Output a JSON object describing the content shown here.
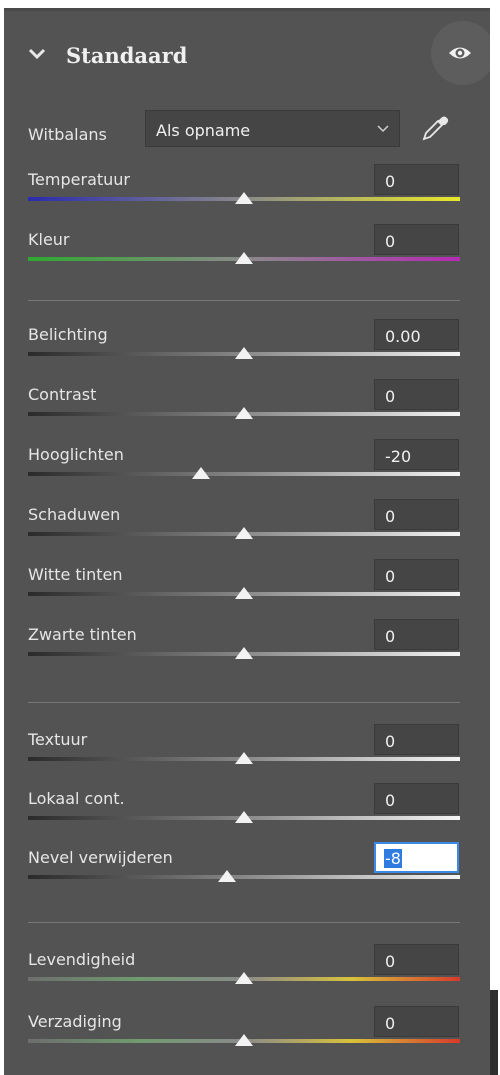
{
  "section": {
    "title": "Standaard"
  },
  "white_balance": {
    "label": "Witbalans",
    "value": "Als opname"
  },
  "groups": [
    [
      {
        "label": "Temperatuur",
        "value": "0",
        "position": 0.5,
        "gradient": "linear-gradient(to right,#2b2bb0,#8a8a8a 50%,#e8e82a)"
      },
      {
        "label": "Kleur",
        "value": "0",
        "position": 0.5,
        "gradient": "linear-gradient(to right,#2fa82f,#8a8a8a 50%,#b52ab5)"
      }
    ],
    [
      {
        "label": "Belichting",
        "value": "0.00",
        "position": 0.5,
        "gradient": "linear-gradient(to right,#2a2a2a,#888 50%,#f5f5f5)"
      },
      {
        "label": "Contrast",
        "value": "0",
        "position": 0.5,
        "gradient": "linear-gradient(to right,#2a2a2a,#888 50%,#f5f5f5)"
      },
      {
        "label": "Hooglichten",
        "value": "-20",
        "position": 0.4,
        "gradient": "linear-gradient(to right,#2a2a2a,#888 50%,#f5f5f5)"
      },
      {
        "label": "Schaduwen",
        "value": "0",
        "position": 0.5,
        "gradient": "linear-gradient(to right,#2a2a2a,#888 50%,#f5f5f5)"
      },
      {
        "label": "Witte tinten",
        "value": "0",
        "position": 0.5,
        "gradient": "linear-gradient(to right,#2a2a2a,#888 50%,#f5f5f5)"
      },
      {
        "label": "Zwarte tinten",
        "value": "0",
        "position": 0.5,
        "gradient": "linear-gradient(to right,#2a2a2a,#888 50%,#f5f5f5)"
      }
    ],
    [
      {
        "label": "Textuur",
        "value": "0",
        "position": 0.5,
        "gradient": "linear-gradient(to right,#2a2a2a,#888 50%,#f5f5f5)"
      },
      {
        "label": "Lokaal cont.",
        "value": "0",
        "position": 0.5,
        "gradient": "linear-gradient(to right,#2a2a2a,#888 50%,#f5f5f5)"
      },
      {
        "label": "Nevel verwijderen",
        "value": "-8",
        "position": 0.46,
        "active": true,
        "gradient": "linear-gradient(to right,#2a2a2a,#888 50%,#f5f5f5)"
      }
    ],
    [
      {
        "label": "Levendigheid",
        "value": "0",
        "position": 0.5,
        "gradient": "linear-gradient(to right,#6e6e6e,#6f9a6f 25%,#8a8a8a 50%,#d8c23a 75%,#d83a2a)"
      },
      {
        "label": "Verzadiging",
        "value": "0",
        "position": 0.5,
        "gradient": "linear-gradient(to right,#6e6e6e,#6f9a6f 25%,#8a8a8a 50%,#d8c23a 75%,#d83a2a)"
      }
    ]
  ]
}
